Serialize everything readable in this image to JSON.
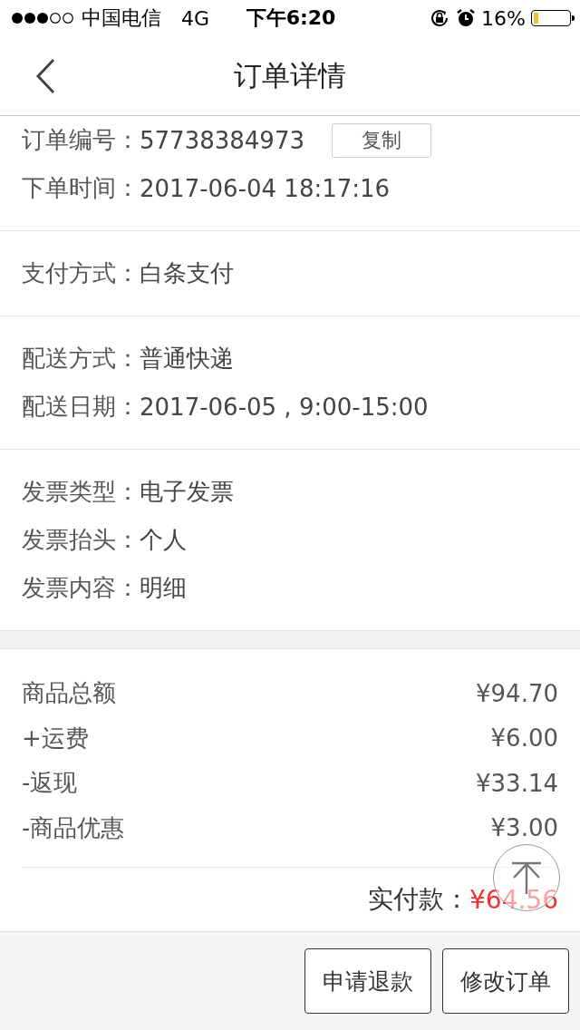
{
  "status_bar": {
    "carrier": "中国电信",
    "network": "4G",
    "time": "下午6:20",
    "battery_percent": "16%",
    "battery": {
      "level": 0.12
    }
  },
  "nav": {
    "title": "订单详情"
  },
  "sections": [
    {
      "rows": [
        {
          "label": "订单编号：",
          "value": "57738384973",
          "action": "复制"
        },
        {
          "label": "下单时间：",
          "value": "2017-06-04 18:17:16"
        }
      ]
    },
    {
      "rows": [
        {
          "label": "支付方式：",
          "value": "白条支付"
        }
      ]
    },
    {
      "rows": [
        {
          "label": "配送方式：",
          "value": "普通快递"
        },
        {
          "label": "配送日期：",
          "value": "2017-06-05 , 9:00-15:00"
        }
      ]
    },
    {
      "rows": [
        {
          "label": "发票类型：",
          "value": "电子发票"
        },
        {
          "label": "发票抬头：",
          "value": "个人"
        },
        {
          "label": "发票内容：",
          "value": "明细"
        }
      ]
    }
  ],
  "amounts": [
    {
      "label": "商品总额",
      "value": "¥94.70"
    },
    {
      "label": "+运费",
      "value": "¥6.00"
    },
    {
      "label": "-返现",
      "value": "¥33.14"
    },
    {
      "label": "-商品优惠",
      "value": "¥3.00"
    }
  ],
  "total": {
    "label": "实付款：",
    "value": "¥64.56"
  },
  "buttons": [
    "申请退款",
    "修改订单"
  ]
}
